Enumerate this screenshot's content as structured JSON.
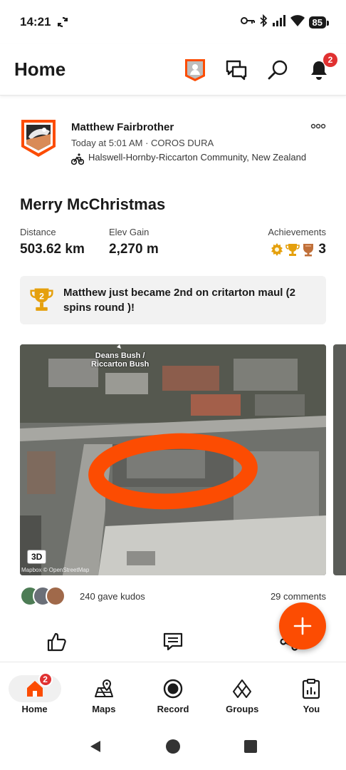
{
  "status_bar": {
    "time": "14:21",
    "battery": "85"
  },
  "header": {
    "title": "Home",
    "notification_count": "2"
  },
  "activity": {
    "athlete_name": "Matthew Fairbrother",
    "time_device": "Today at 5:01 AM · COROS DURA",
    "location": "Halswell-Hornby-Riccarton Community, New Zealand",
    "title": "Merry McChristmas",
    "stats": {
      "distance_label": "Distance",
      "distance_value": "503.62 km",
      "elev_label": "Elev Gain",
      "elev_value": "2,270 m",
      "achievements_label": "Achievements",
      "achievements_value": "3"
    },
    "achievement_banner": {
      "rank": "2",
      "text": "Matthew just became 2nd on critarton maul (2 spins round )!"
    },
    "map": {
      "place_label_line1": "Deans Bush /",
      "place_label_line2": "Riccarton Bush",
      "button_3d": "3D",
      "credit": "Mapbox © OpenStreetMap"
    },
    "kudos_text": "240 gave kudos",
    "comments_text": "29 comments"
  },
  "bottom_nav": {
    "items": [
      {
        "label": "Home",
        "badge": "2"
      },
      {
        "label": "Maps"
      },
      {
        "label": "Record"
      },
      {
        "label": "Groups"
      },
      {
        "label": "You"
      }
    ]
  },
  "colors": {
    "brand_orange": "#fc4c02",
    "badge_red": "#e03131",
    "gold": "#e5a00d"
  }
}
